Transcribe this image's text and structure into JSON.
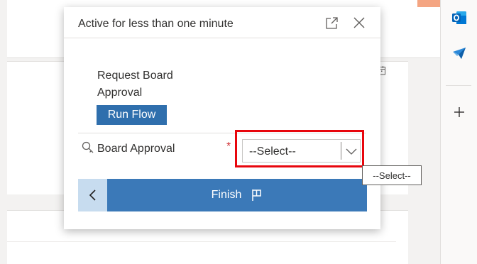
{
  "dialog": {
    "title": "Active for less than one minute",
    "step_label": "Request Board Approval",
    "run_flow_label": "Run Flow",
    "field_label": "Board Approval",
    "required_marker": "*",
    "select_value": "--Select--",
    "finish_label": "Finish"
  },
  "tooltip": {
    "text": "--Select--"
  },
  "icons": {
    "popout": "popout-icon",
    "close": "close-icon",
    "field": "lookup-search-icon",
    "chevron": "chevron-down-icon",
    "back": "chevron-left-icon",
    "finish": "flag-icon",
    "outlook": "outlook-icon",
    "send": "send-icon",
    "plus": "plus-icon",
    "calendar": "calendar-icon"
  },
  "colors": {
    "accent": "#3b79b8",
    "run_flow_button": "#2f6fad",
    "back_button": "#c7dcef",
    "highlight": "#e8060d",
    "required": "#d13438"
  }
}
